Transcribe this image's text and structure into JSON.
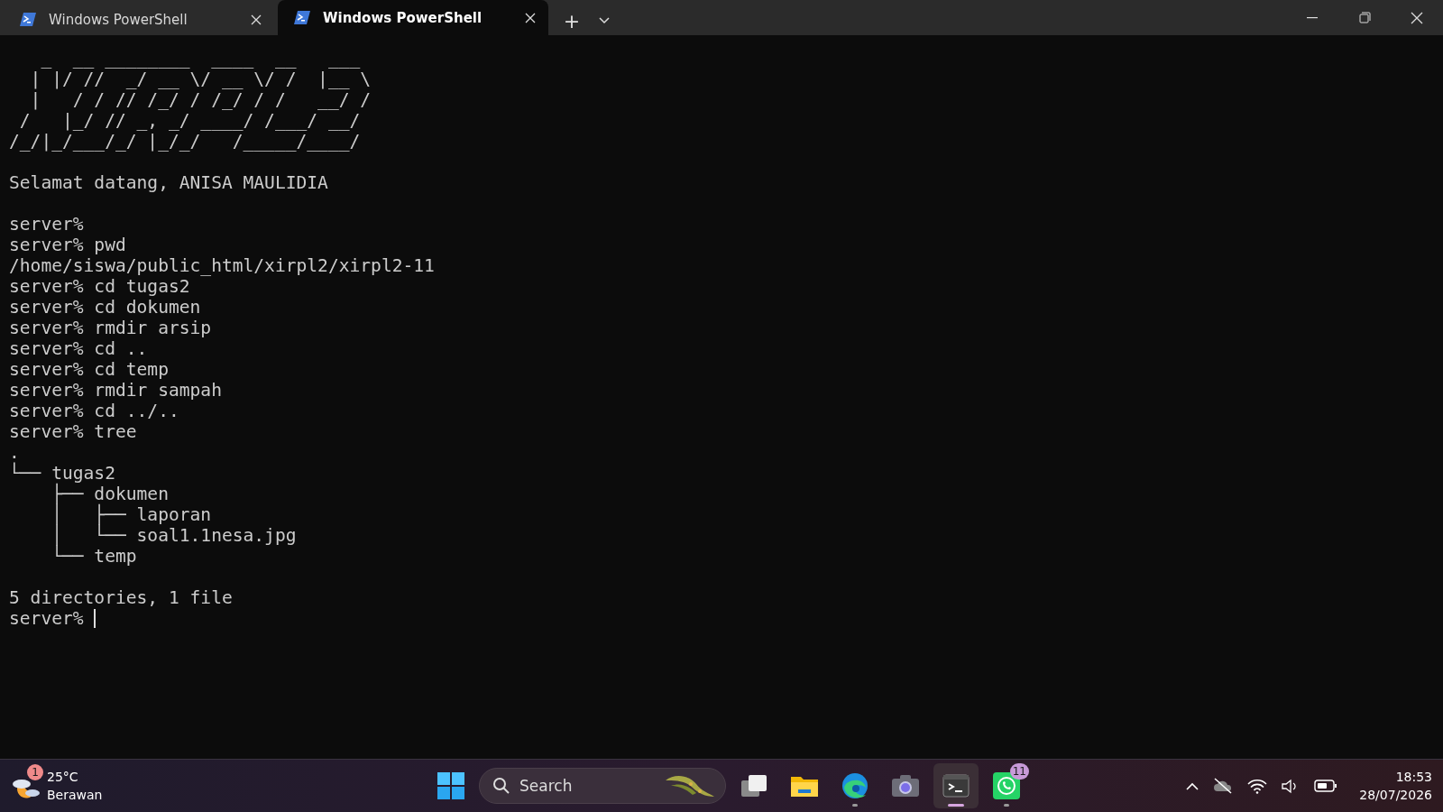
{
  "tabs": [
    {
      "title": "Windows PowerShell",
      "selected": false
    },
    {
      "title": "Windows PowerShell",
      "selected": true
    }
  ],
  "new_tab": "+",
  "terminal": {
    "blocks": [
      [
        "   _  __ ________  ____  __   ___ ",
        "  | |/ //  _/ __ \\/ __ \\/ /  |__ \\",
        "  |   / / // /_/ / /_/ / /   __/ /",
        " /   |_/ // _, _/ ____/ /___/ __/ ",
        "/_/|_/___/_/ |_/_/   /_____/____/  "
      ],
      [
        "Selamat datang, ANISA MAULIDIA"
      ],
      [
        "server%",
        "server% pwd",
        "/home/siswa/public_html/xirpl2/xirpl2-11",
        "server% cd tugas2",
        "server% cd dokumen",
        "server% rmdir arsip",
        "server% cd ..",
        "server% cd temp",
        "server% rmdir sampah",
        "server% cd ../..",
        "server% tree",
        ".",
        "└── tugas2",
        "    ├── dokumen",
        "    │   ├── laporan",
        "    │   └── soal1.1nesa.jpg",
        "    └── temp"
      ],
      [
        "5 directories, 1 file"
      ]
    ],
    "prompt": "server% ",
    "cursor": true
  },
  "taskbar": {
    "weather": {
      "temp": "25°C",
      "condition": "Berawan",
      "badge": "1"
    },
    "search": {
      "placeholder": "Search"
    },
    "apps": [
      {
        "kind": "taskview",
        "active": false,
        "running": false
      },
      {
        "kind": "explorer",
        "active": false,
        "running": false
      },
      {
        "kind": "edge",
        "active": false,
        "running": true
      },
      {
        "kind": "camera",
        "active": false,
        "running": false
      },
      {
        "kind": "terminal",
        "active": true,
        "running": true
      },
      {
        "kind": "whatsapp",
        "active": false,
        "running": true,
        "badge": "11"
      }
    ],
    "time": "18:53",
    "date": "28/07/2026"
  }
}
